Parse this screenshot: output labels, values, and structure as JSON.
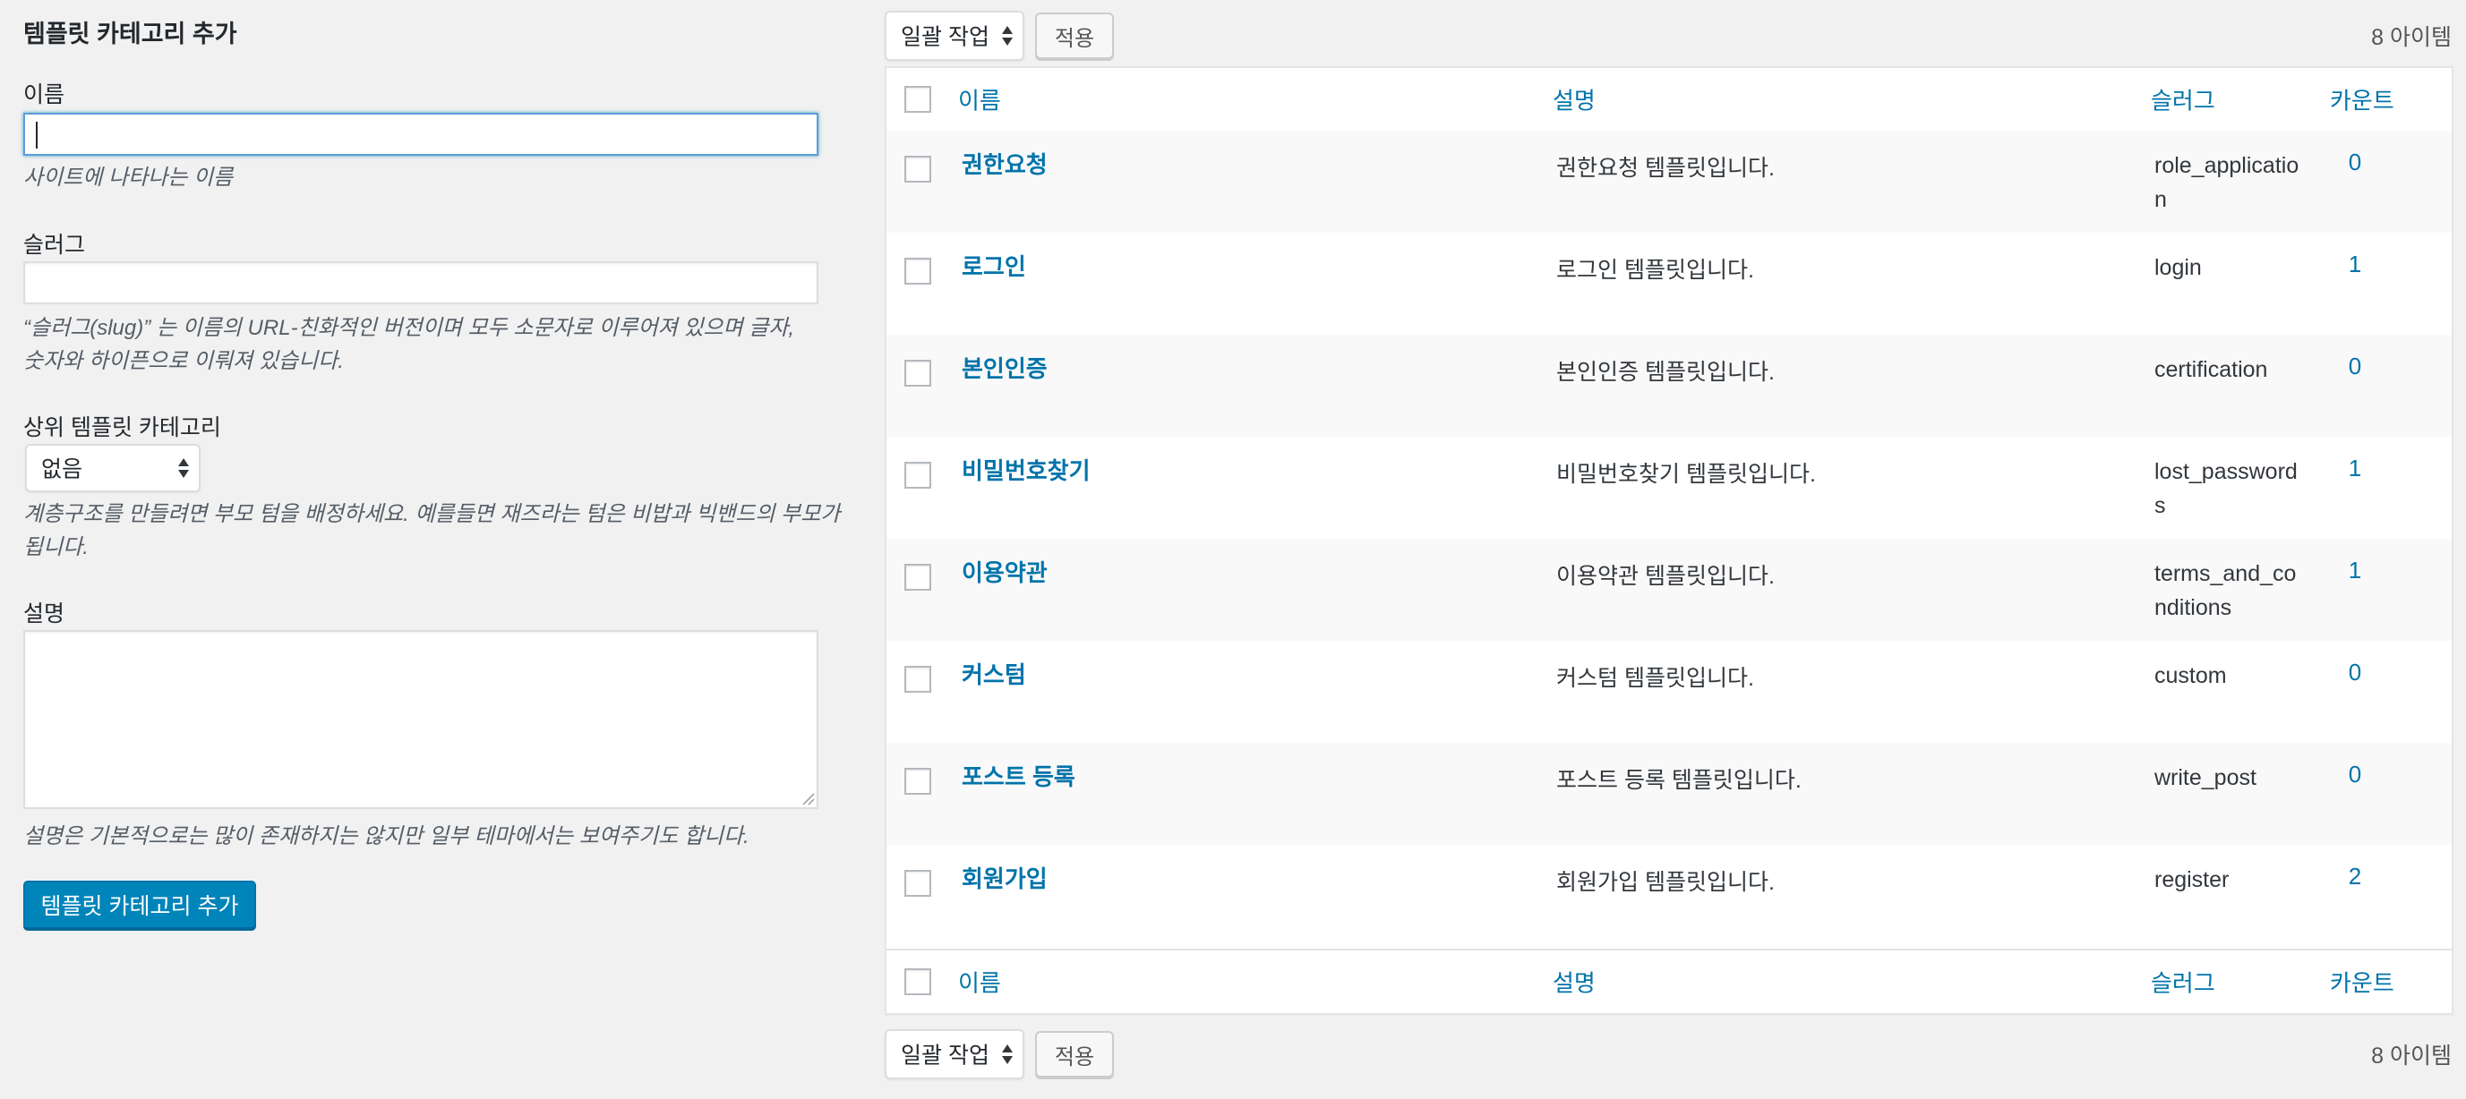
{
  "form": {
    "title": "템플릿 카테고리 추가",
    "name_label": "이름",
    "name_value": "",
    "name_desc": "사이트에 나타나는 이름",
    "slug_label": "슬러그",
    "slug_value": "",
    "slug_desc_line1": "“슬러그(slug)” 는 이름의 URL-친화적인 버전이며 모두 소문자로 이루어져 있으며 글자,",
    "slug_desc_line2": "숫자와 하이픈으로 이뤄져 있습니다.",
    "parent_label": "상위 템플릿 카테고리",
    "parent_selected": "없음",
    "parent_desc_line1": "계층구조를 만들려면 부모 텀을 배정하세요. 예를들면 재즈라는 텀은 비밥과 빅밴드의 부모가",
    "parent_desc_line2": "됩니다.",
    "description_label": "설명",
    "description_value": "",
    "description_desc": "설명은 기본적으로는 많이 존재하지는 않지만 일부 테마에서는 보여주기도 합니다.",
    "submit_label": "템플릿 카테고리 추가"
  },
  "bulk": {
    "select_label": "일괄 작업",
    "apply_label": "적용",
    "count_label": "8 아이템"
  },
  "table": {
    "headers": {
      "name": "이름",
      "description": "설명",
      "slug": "슬러그",
      "count": "카운트"
    },
    "rows": [
      {
        "name": "권한요청",
        "description": "권한요청 템플릿입니다.",
        "slug": "role_application",
        "count": "0"
      },
      {
        "name": "로그인",
        "description": "로그인 템플릿입니다.",
        "slug": "login",
        "count": "1"
      },
      {
        "name": "본인인증",
        "description": "본인인증 템플릿입니다.",
        "slug": "certification",
        "count": "0"
      },
      {
        "name": "비밀번호찾기",
        "description": "비밀번호찾기 템플릿입니다.",
        "slug": "lost_passwords",
        "count": "1"
      },
      {
        "name": "이용약관",
        "description": "이용약관 템플릿입니다.",
        "slug": "terms_and_conditions",
        "count": "1"
      },
      {
        "name": "커스텀",
        "description": "커스텀 템플릿입니다.",
        "slug": "custom",
        "count": "0"
      },
      {
        "name": "포스트 등록",
        "description": "포스트 등록 템플릿입니다.",
        "slug": "write_post",
        "count": "0"
      },
      {
        "name": "회원가입",
        "description": "회원가입 템플릿입니다.",
        "slug": "register",
        "count": "2"
      }
    ]
  },
  "colors": {
    "link": "#0073aa",
    "primary_button": "#0085ba",
    "background": "#f1f1f1",
    "focus_border": "#5b9dd9"
  },
  "icons": {
    "select_arrows": "select-arrows-icon",
    "resize_grip": "resize-grip-icon"
  }
}
